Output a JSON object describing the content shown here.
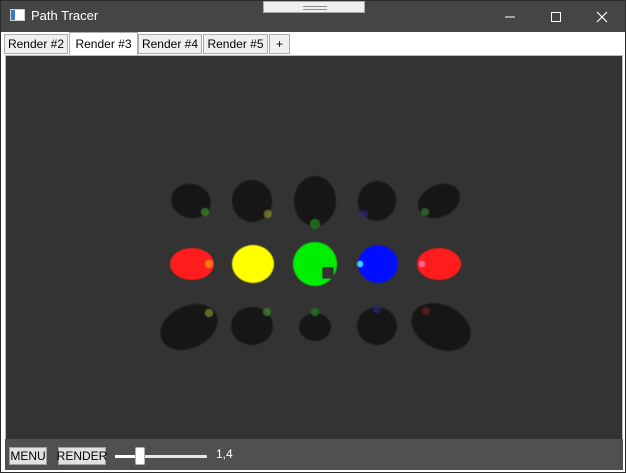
{
  "window": {
    "title": "Path Tracer"
  },
  "tabs": [
    {
      "label": "Render #2",
      "active": false
    },
    {
      "label": "Render #3",
      "active": true
    },
    {
      "label": "Render #4",
      "active": false
    },
    {
      "label": "Render #5",
      "active": false
    },
    {
      "label": "+",
      "active": false
    }
  ],
  "toolbar": {
    "menu_label": "MENU",
    "render_label": "RENDER",
    "slider_value": "1,4",
    "slider_fraction": 0.27
  },
  "scene": {
    "background_color": "#333333",
    "emissive_spheres": [
      "red",
      "yellow",
      "green",
      "blue",
      "red"
    ],
    "colors": {
      "red": "#ff1a1a",
      "yellow": "#ffff00",
      "green": "#00ee00",
      "blue": "#0010ff",
      "dark": "#161616"
    }
  },
  "icons": {
    "app": "app-window-icon",
    "minimize": "minimize-icon",
    "maximize": "maximize-icon",
    "close": "close-icon"
  }
}
